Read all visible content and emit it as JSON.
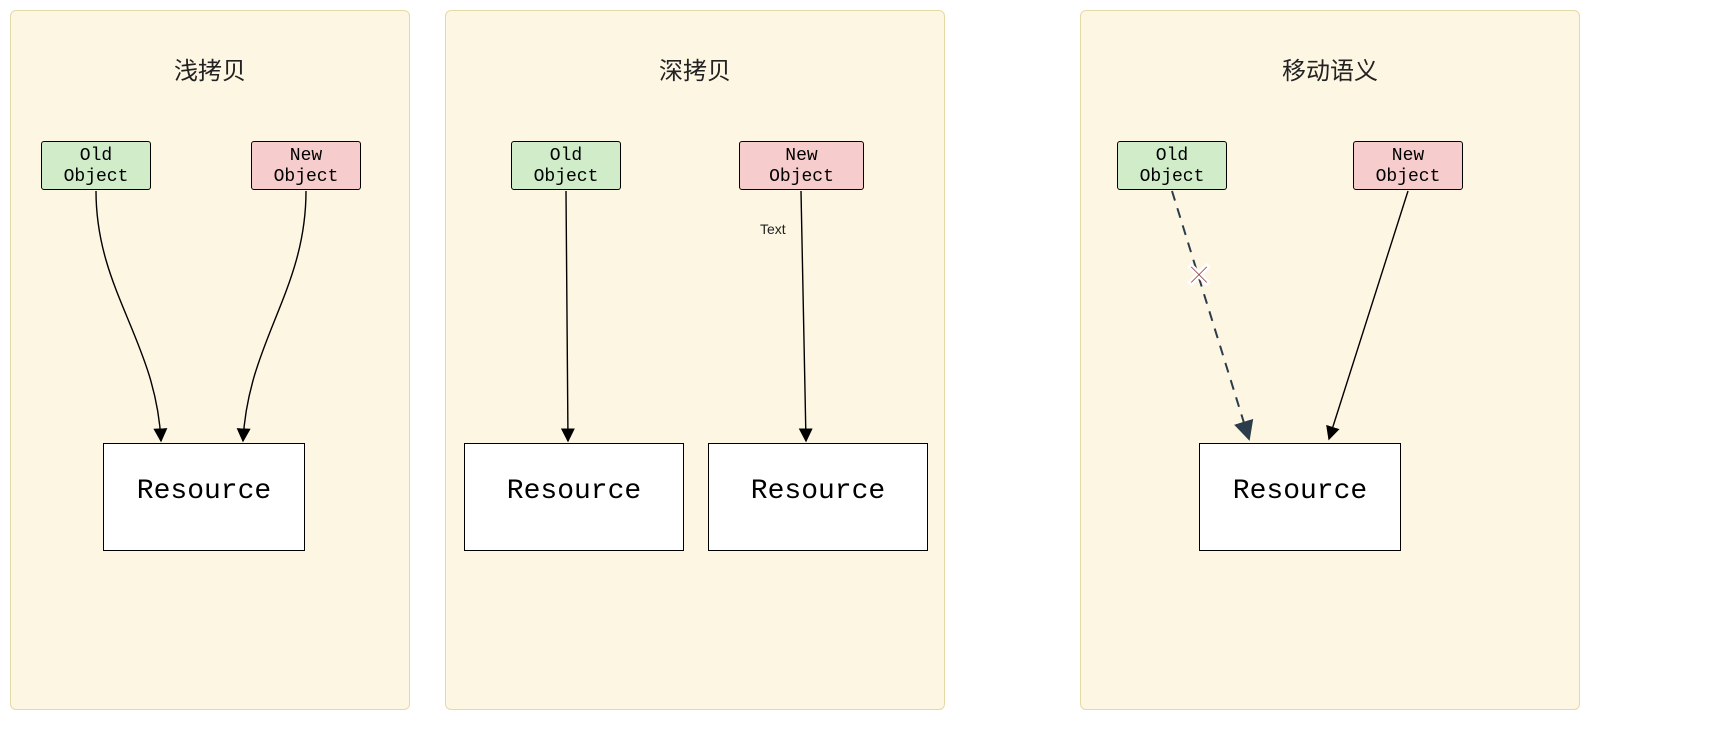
{
  "diagram": {
    "shallow": {
      "title": "浅拷贝",
      "old_line1": "Old",
      "old_line2": "Object",
      "new_line1": "New",
      "new_line2": "Object",
      "resource": "Resource"
    },
    "deep": {
      "title": "深拷贝",
      "old_line1": "Old",
      "old_line2": "Object",
      "new_line1": "New",
      "new_line2": "Object",
      "edge_label": "Text",
      "resource1": "Resource",
      "resource2": "Resource"
    },
    "move": {
      "title": "移动语义",
      "old_line1": "Old",
      "old_line2": "Object",
      "new_line1": "New",
      "new_line2": "Object",
      "resource": "Resource"
    },
    "colors": {
      "panel_bg": "#fdf6e3",
      "panel_border": "#e6d9a8",
      "old_bg": "#d1ecc9",
      "new_bg": "#f7cccc",
      "cross": "#8b1e1e",
      "dashed_stroke": "#2b3c4a"
    }
  }
}
